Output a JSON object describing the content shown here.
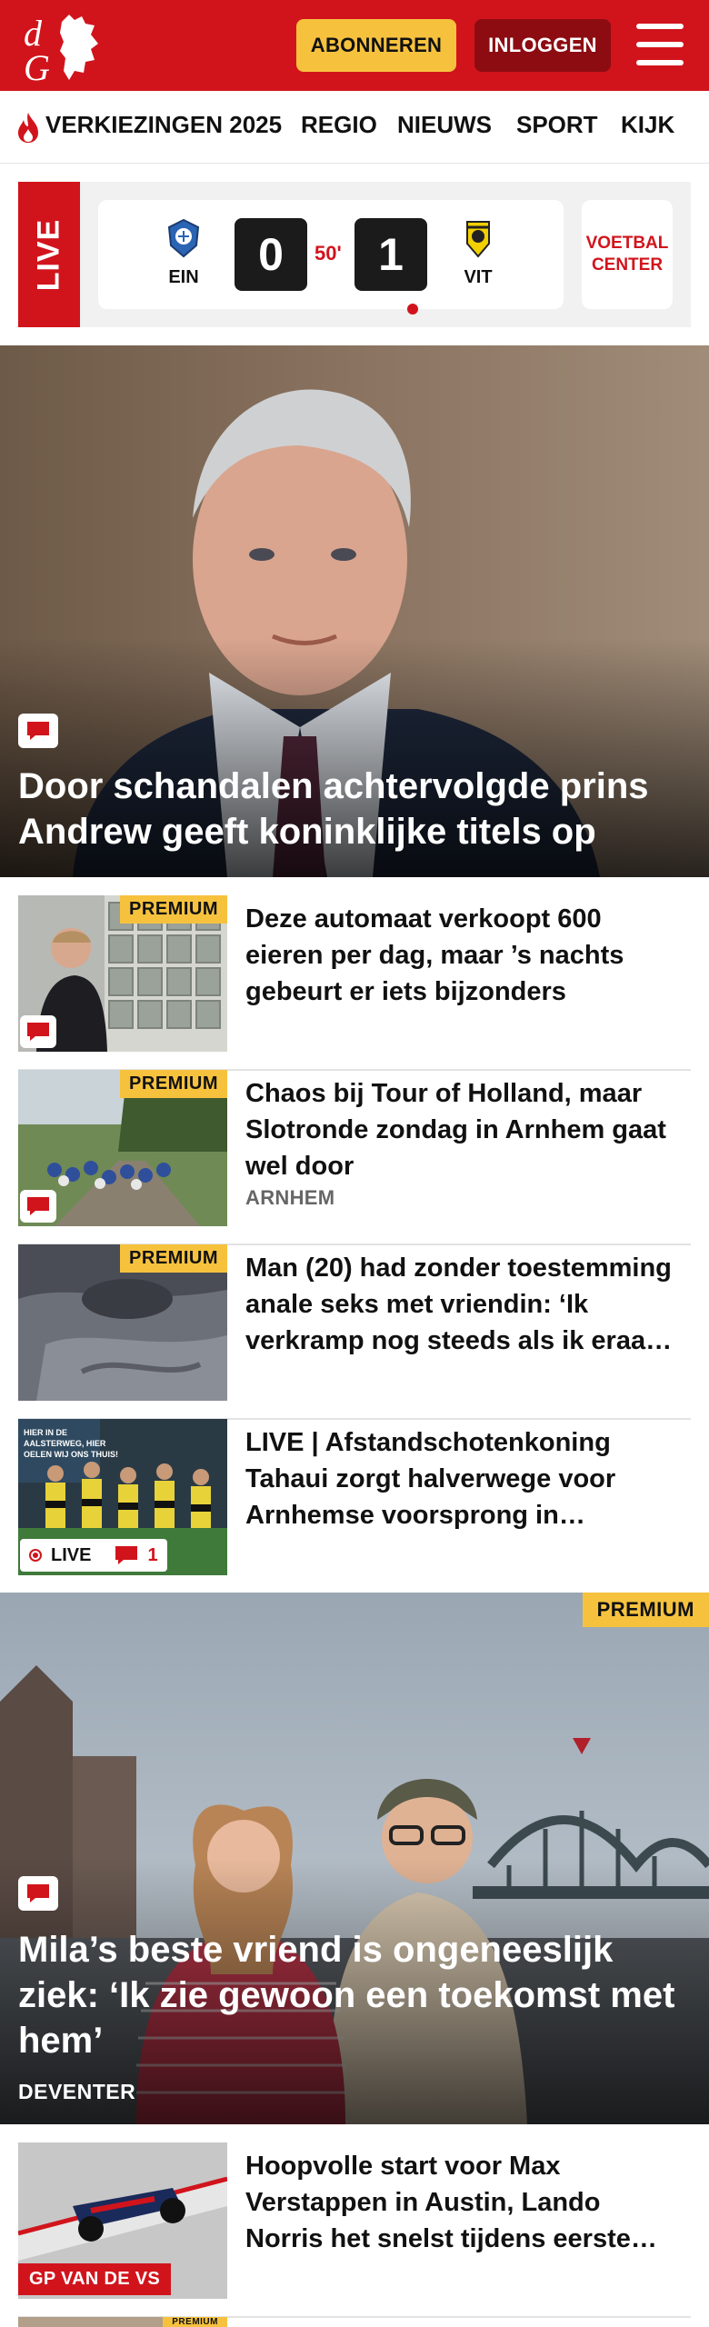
{
  "header": {
    "logo_text": "dG",
    "subscribe_label": "ABONNEREN",
    "login_label": "INLOGGEN",
    "colors": {
      "brand": "#d1141c",
      "accent": "#f6c23e",
      "login_bg": "#8c0c12"
    }
  },
  "nav": {
    "items": [
      {
        "label": "VERKIEZINGEN 2025",
        "icon": "flame-icon"
      },
      {
        "label": "REGIO"
      },
      {
        "label": "NIEUWS"
      },
      {
        "label": "SPORT"
      },
      {
        "label": "KIJK"
      }
    ]
  },
  "live": {
    "tab_label": "LIVE",
    "home_team": "EIN",
    "home_score": "0",
    "minute": "50'",
    "away_team": "VIT",
    "away_score": "1",
    "center_line1": "VOETBAL",
    "center_line2": "CENTER"
  },
  "hero": {
    "title": "Door schandalen achtervolgde prins Andrew geeft koninklijke titels op"
  },
  "articles": [
    {
      "title": "Deze automaat verkoopt 600 eieren per dag, maar ’s nachts gebeurt er iets bijzonders",
      "premium": "PREMIUM"
    },
    {
      "title": "Chaos bij Tour of Holland, maar Slotronde zondag in Arnhem gaat wel door",
      "premium": "PREMIUM",
      "location": "ARNHEM"
    },
    {
      "title": "Man (20) had zonder toestem­ming anale seks met vriendin: ‘Ik verkramp nog steeds als ik eraa…",
      "premium": "PREMIUM"
    },
    {
      "title": "LIVE | Afstandschotenkoning Tahaui zorgt halverwege voor Arnhemse voorsprong in…",
      "live_label": "LIVE",
      "comment_count": "1"
    }
  ],
  "feature": {
    "premium": "PREMIUM",
    "title": "Mila’s beste vriend is ongeneeslijk ziek: ‘Ik zie gewoon een toekomst met hem’",
    "location": "DEVENTER"
  },
  "article_f1": {
    "title": "Hoopvolle start voor Max Verstappen in Austin, Lando Norris het snelst tijdens eerste…",
    "section_label": "GP VAN DE VS"
  },
  "article_partial": {
    "premium": "PREMIUM"
  }
}
